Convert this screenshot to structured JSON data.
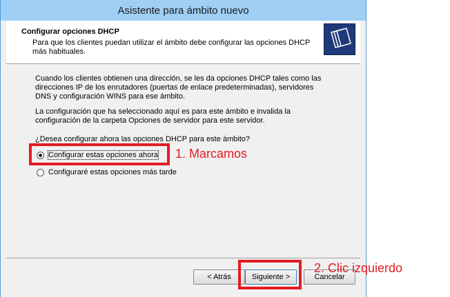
{
  "window": {
    "title": "Asistente para ámbito nuevo"
  },
  "header": {
    "title": "Configurar opciones DHCP",
    "subtitle": "Para que los clientes puedan utilizar el ámbito debe configurar las opciones DHCP más habituales.",
    "icon": "folder-stack-icon"
  },
  "body": {
    "paragraph1": "Cuando los clientes obtienen una dirección, se les da opciones DHCP tales como las direcciones IP de los enrutadores (puertas de enlace predeterminadas), servidores DNS y configuración WINS para ese ámbito.",
    "paragraph2": "La configuración que ha seleccionado aquí es para este ámbito e invalida la configuración de la carpeta Opciones de servidor para este servidor.",
    "question": "¿Desea configurar ahora las opciones DHCP para este ámbito?",
    "options": [
      {
        "label": "Configurar estas opciones ahora",
        "selected": true
      },
      {
        "label": "Configuraré estas opciones más tarde",
        "selected": false
      }
    ]
  },
  "buttons": {
    "back": "< Atrás",
    "next": "Siguiente >",
    "cancel": "Cancelar"
  },
  "annotations": {
    "step1": "1. Marcamos",
    "step2": "2. Clic izquierdo",
    "color": "#e41b23"
  }
}
